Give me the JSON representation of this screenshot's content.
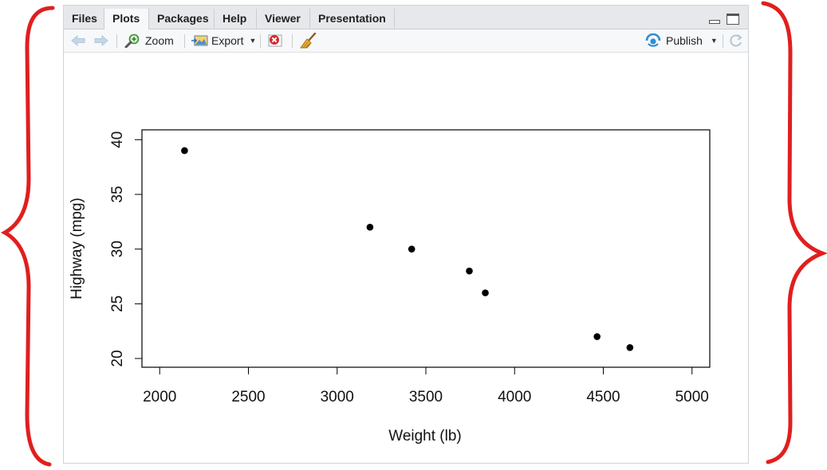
{
  "tabs": [
    {
      "label": "Files"
    },
    {
      "label": "Plots"
    },
    {
      "label": "Packages"
    },
    {
      "label": "Help"
    },
    {
      "label": "Viewer"
    },
    {
      "label": "Presentation"
    }
  ],
  "active_tab": "Plots",
  "toolbar": {
    "zoom_label": "Zoom",
    "export_label": "Export",
    "publish_label": "Publish"
  },
  "icons": {
    "back": "arrow-left-icon",
    "forward": "arrow-right-icon",
    "zoom": "magnifier-icon",
    "export": "image-export-icon",
    "remove": "delete-plot-icon",
    "clear": "broom-icon",
    "publish": "publish-icon",
    "refresh": "refresh-icon"
  },
  "colors": {
    "annotation_brace": "#e01f1f",
    "tabbar_bg": "#e6e8eb",
    "point": "#000000"
  },
  "chart_data": {
    "type": "scatter",
    "xlabel": "Weight (lb)",
    "ylabel": "Highway (mpg)",
    "xlim": [
      1900,
      5100
    ],
    "ylim": [
      19.2,
      40.9
    ],
    "xticks": [
      2000,
      2500,
      3000,
      3500,
      4000,
      4500,
      5000
    ],
    "yticks": [
      20,
      25,
      30,
      35,
      40
    ],
    "grid": false,
    "points": [
      {
        "x": 2140,
        "y": 39
      },
      {
        "x": 3185,
        "y": 32
      },
      {
        "x": 3420,
        "y": 30
      },
      {
        "x": 3745,
        "y": 28
      },
      {
        "x": 3835,
        "y": 26
      },
      {
        "x": 4465,
        "y": 22
      },
      {
        "x": 4650,
        "y": 21
      }
    ]
  }
}
